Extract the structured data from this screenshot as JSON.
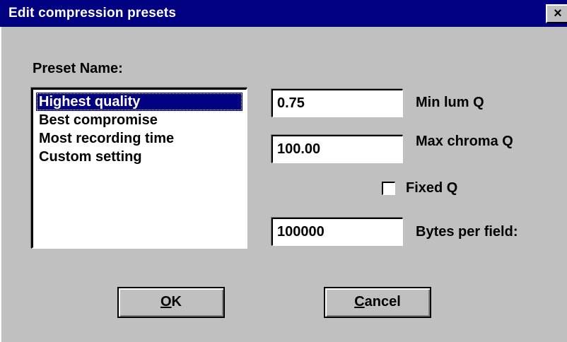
{
  "window": {
    "title": "Edit compression presets",
    "close_glyph": "×"
  },
  "preset": {
    "label": "Preset Name:",
    "items": [
      {
        "label": "Highest quality",
        "selected": true
      },
      {
        "label": "Best compromise",
        "selected": false
      },
      {
        "label": "Most recording time",
        "selected": false
      },
      {
        "label": "Custom setting",
        "selected": false
      }
    ]
  },
  "fields": {
    "min_lum_q": {
      "value": " 0.75",
      "label": "Min lum Q"
    },
    "max_chroma_q": {
      "value": "100.00",
      "label": "Max chroma Q"
    },
    "fixed_q": {
      "label": "Fixed Q",
      "checked": false
    },
    "bytes_per_field": {
      "value": "100000",
      "label": "Bytes per field:"
    }
  },
  "buttons": {
    "ok": {
      "accel": "O",
      "rest": "K"
    },
    "cancel": {
      "accel": "C",
      "rest": "ancel"
    }
  },
  "colors": {
    "title_bar": "#000080",
    "face": "#c0c0c0",
    "selection": "#000080"
  }
}
